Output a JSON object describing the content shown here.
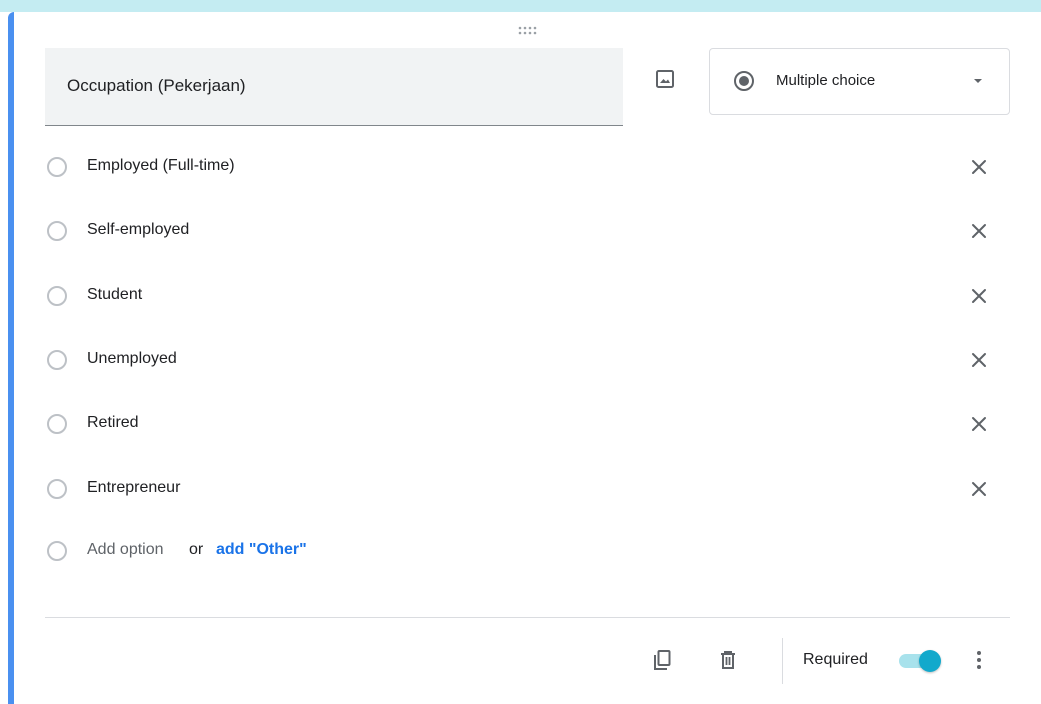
{
  "question": {
    "title": "Occupation (Pekerjaan)",
    "image_icon": "image-icon"
  },
  "type_selector": {
    "selected": "Multiple choice",
    "icon": "radio-button-checked-icon"
  },
  "options": [
    {
      "label": "Employed (Full-time)"
    },
    {
      "label": "Self-employed"
    },
    {
      "label": "Student"
    },
    {
      "label": "Unemployed"
    },
    {
      "label": "Retired"
    },
    {
      "label": "Entrepreneur"
    }
  ],
  "add_option": {
    "label": "Add option",
    "or": "or",
    "other_link": "add \"Other\""
  },
  "footer": {
    "required_label": "Required",
    "required_on": true,
    "icons": [
      "copy-icon",
      "delete-icon",
      "more-vert-icon"
    ]
  },
  "colors": {
    "accent_bar": "#4a90f0",
    "top_strip": "#c4ecf2",
    "link": "#1a73e8",
    "toggle_knob": "#12a9cc",
    "toggle_track": "#a8e2ec"
  }
}
